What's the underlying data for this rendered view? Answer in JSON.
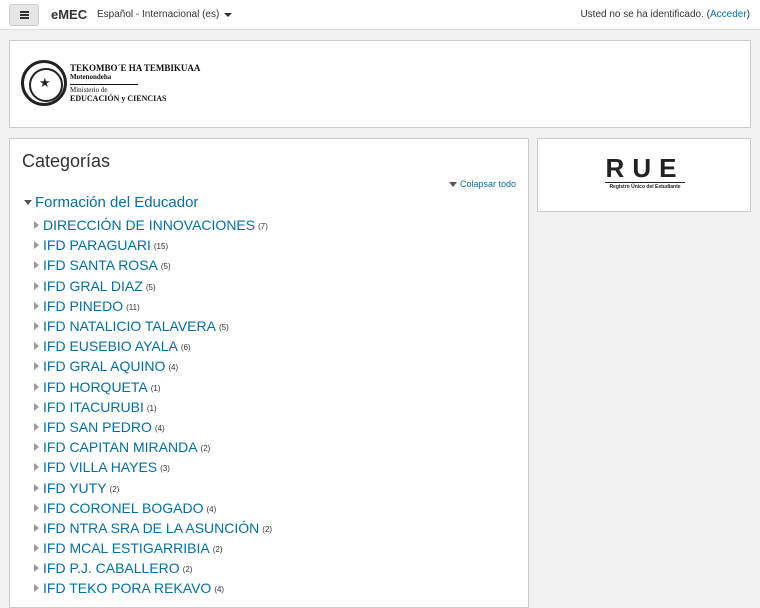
{
  "navbar": {
    "brand": "eMEC",
    "language": "Español - Internacional (es)",
    "login_text": "Usted no se ha identificado. (",
    "login_link": "Acceder",
    "login_close": ")"
  },
  "header": {
    "logo_line1": "TEKOMBO´E HA TEMBIKUAA",
    "logo_line2": "Motenondeha",
    "logo_line3": "Ministerio de",
    "logo_line4": "EDUCACIÓN y CIENCIAS"
  },
  "main": {
    "title": "Categorías",
    "collapse_all": "Colapsar todo",
    "root_category": "Formación del Educador",
    "categories": [
      {
        "name": "DIRECCIÓN DE INNOVACIONES",
        "count": "(7)"
      },
      {
        "name": "IFD PARAGUARI",
        "count": "(15)"
      },
      {
        "name": "IFD SANTA ROSA",
        "count": "(5)"
      },
      {
        "name": "IFD GRAL DIAZ",
        "count": "(5)"
      },
      {
        "name": "IFD PINEDO",
        "count": "(11)"
      },
      {
        "name": "IFD NATALICIO TALAVERA",
        "count": "(5)"
      },
      {
        "name": "IFD EUSEBIO AYALA",
        "count": "(6)"
      },
      {
        "name": "IFD GRAL AQUINO",
        "count": "(4)"
      },
      {
        "name": "IFD HORQUETA",
        "count": "(1)"
      },
      {
        "name": "IFD ITACURUBI",
        "count": "(1)"
      },
      {
        "name": "IFD SAN PEDRO",
        "count": "(4)"
      },
      {
        "name": "IFD CAPITAN MIRANDA",
        "count": "(2)"
      },
      {
        "name": "IFD VILLA HAYES",
        "count": "(3)"
      },
      {
        "name": "IFD YUTY",
        "count": "(2)"
      },
      {
        "name": "IFD CORONEL BOGADO",
        "count": "(4)"
      },
      {
        "name": "IFD NTRA SRA DE LA ASUNCIÓN",
        "count": "(2)"
      },
      {
        "name": "IFD MCAL ESTIGARRIBIA",
        "count": "(2)"
      },
      {
        "name": "IFD P.J. CABALLERO",
        "count": "(2)"
      },
      {
        "name": "IFD TEKO PORA REKAVO",
        "count": "(4)"
      }
    ]
  },
  "side": {
    "rue_title": "RUE",
    "rue_subtitle": "Registro Único del Estudiante"
  }
}
